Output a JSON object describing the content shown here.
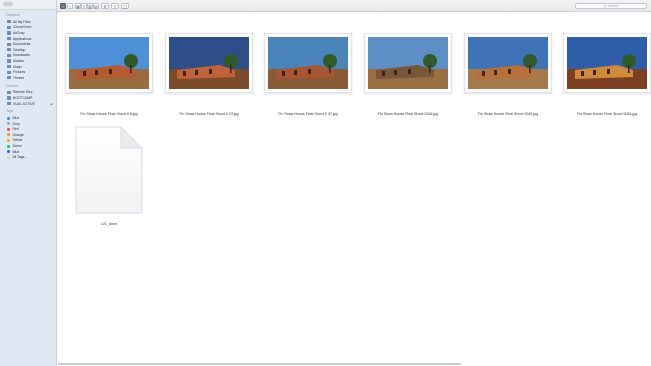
{
  "sidebar": {
    "favorites_title": "Favorites",
    "favorites": [
      {
        "label": "All My Files",
        "icon": "all-files-icon"
      },
      {
        "label": "iCloud Drive",
        "icon": "cloud-icon"
      },
      {
        "label": "AirDrop",
        "icon": "airdrop-icon"
      },
      {
        "label": "Applications",
        "icon": "applications-icon"
      },
      {
        "label": "Documents",
        "icon": "documents-icon"
      },
      {
        "label": "Desktop",
        "icon": "desktop-icon"
      },
      {
        "label": "Downloads",
        "icon": "downloads-icon"
      },
      {
        "label": "Movies",
        "icon": "movies-icon"
      },
      {
        "label": "Music",
        "icon": "music-icon"
      },
      {
        "label": "Pictures",
        "icon": "pictures-icon"
      },
      {
        "label": "Theses",
        "icon": "folder-icon"
      }
    ],
    "devices_title": "Devices",
    "devices": [
      {
        "label": "Remote Disc",
        "icon": "disc-icon"
      },
      {
        "label": "BOOTCAMP",
        "icon": "drive-icon"
      },
      {
        "label": "DUAL ACTIVE",
        "icon": "drive-icon",
        "eject": "⏏"
      }
    ],
    "tags_title": "Tags",
    "tags": [
      {
        "label": "Blue",
        "color": "#3b82f6"
      },
      {
        "label": "Grey",
        "color": "#9ca3af"
      },
      {
        "label": "Red",
        "color": "#ef4444"
      },
      {
        "label": "Orange",
        "color": "#f59e0b"
      },
      {
        "label": "Yellow",
        "color": "#eab308"
      },
      {
        "label": "Green",
        "color": "#22c55e"
      },
      {
        "label": "Blue",
        "color": "#2563eb"
      },
      {
        "label": "All Tags...",
        "color": "#d1d5db"
      }
    ]
  },
  "toolbar": {
    "back": "‹",
    "forward": "›",
    "view_icons": "▦",
    "view_list": "≡",
    "view_columns": "▥",
    "view_gallery": "▤",
    "arrange": "⚙",
    "share": "⇪",
    "tags": "◯",
    "search_placeholder": "Q Search"
  },
  "files": [
    {
      "name": "Fin Shaw House Final Shoot 0 8.jpg",
      "sky": "#4f8fd6",
      "ground": "#9b6a3e",
      "building": "#b55a32"
    },
    {
      "name": "Fin Shaw House Final Shoot 0 23.jpg",
      "sky": "#2c4f8a",
      "ground": "#7c4a2c",
      "building": "#c0623a"
    },
    {
      "name": "Fin Shaw House Final Shoot 0 37.jpg",
      "sky": "#4a84b8",
      "ground": "#8a5a34",
      "building": "#a85631"
    },
    {
      "name": "Fin Shaw House Final Shoot 0048.jpg",
      "sky": "#5d8fc4",
      "ground": "#9a6f44",
      "building": "#7a5638"
    },
    {
      "name": "Fin Shaw House Final Shoot 0049.jpg",
      "sky": "#3e73b6",
      "ground": "#a77a4d",
      "building": "#b8703d"
    },
    {
      "name": "Fin Shaw House Final Shoot 0053.jpg",
      "sky": "#2f5da8",
      "ground": "#7c3f24",
      "building": "#d08a3e"
    }
  ],
  "doc_file": {
    "name": "LVL_done"
  }
}
